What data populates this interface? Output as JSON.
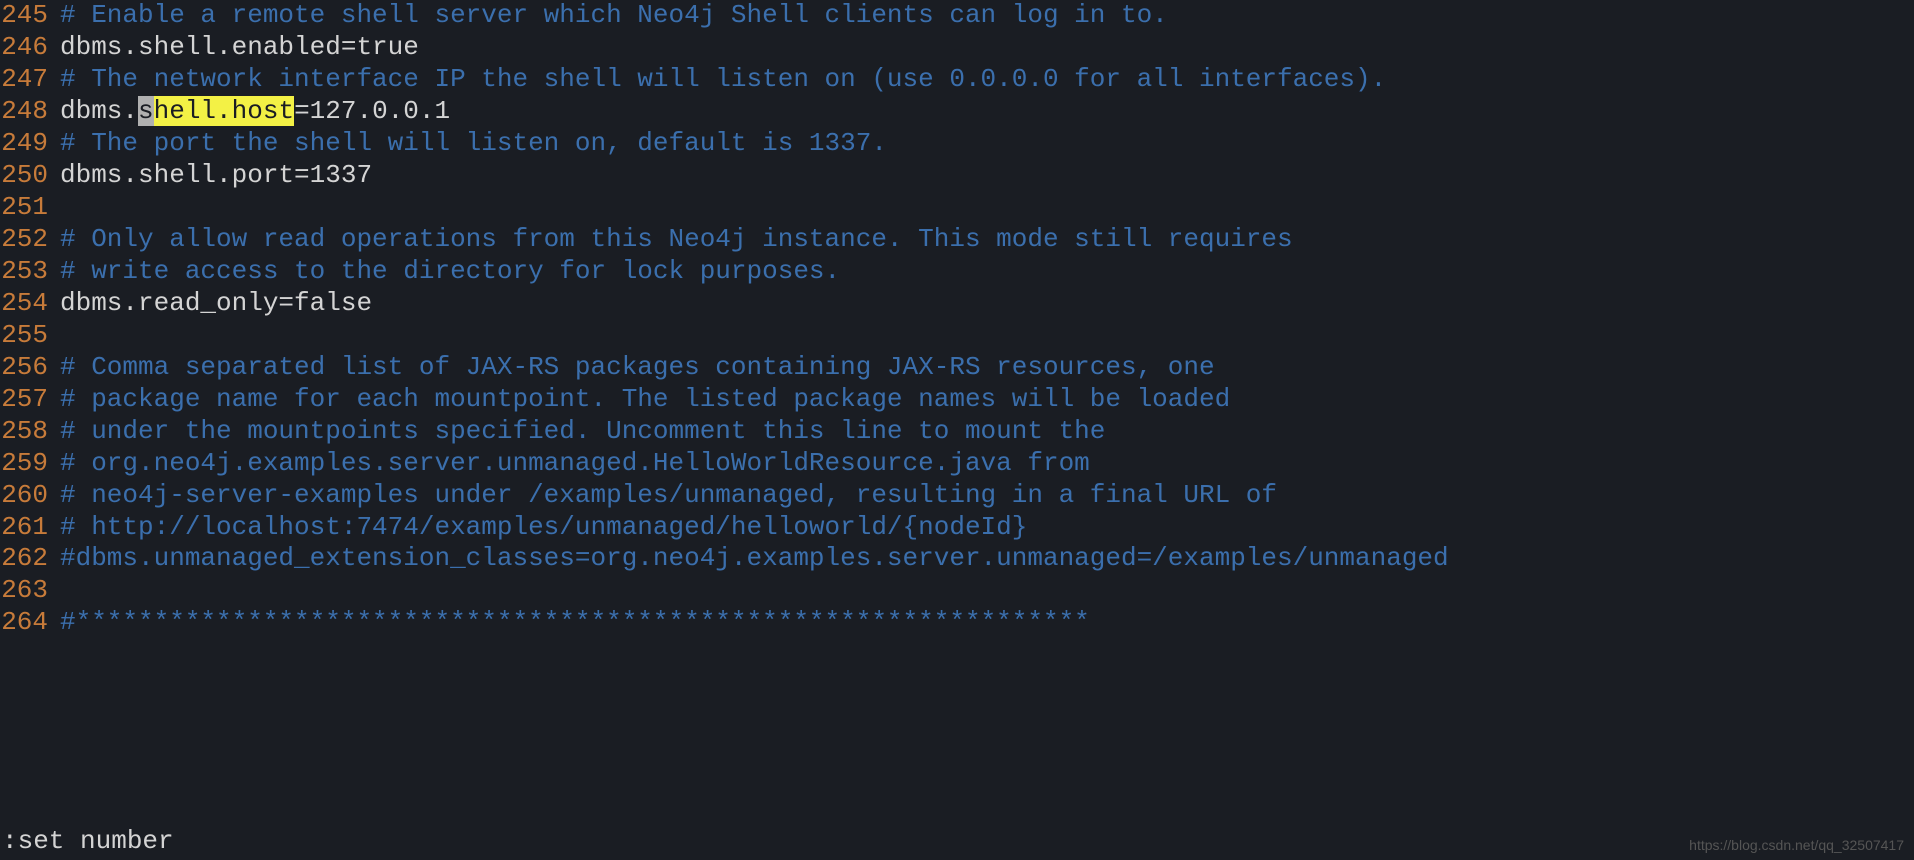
{
  "startLine": 245,
  "lines": [
    {
      "n": "245",
      "spans": [
        {
          "cls": "comment",
          "t": "# Enable a remote shell server which Neo4j Shell clients can log in to."
        }
      ]
    },
    {
      "n": "246",
      "spans": [
        {
          "cls": "setting",
          "t": "dbms.shell.enabled=true"
        }
      ]
    },
    {
      "n": "247",
      "spans": [
        {
          "cls": "comment",
          "t": "# The network interface IP the shell will listen on (use 0.0.0.0 for all interfaces)."
        }
      ]
    },
    {
      "n": "248",
      "spans": [
        {
          "cls": "setting",
          "t": "dbms."
        },
        {
          "cls": "highlight-partial-bg",
          "t": "s"
        },
        {
          "cls": "highlight",
          "t": "hell.host"
        },
        {
          "cls": "setting",
          "t": "=127.0.0.1"
        }
      ]
    },
    {
      "n": "249",
      "spans": [
        {
          "cls": "comment",
          "t": "# The port the shell will listen on, default is 1337."
        }
      ]
    },
    {
      "n": "250",
      "spans": [
        {
          "cls": "setting",
          "t": "dbms.shell.port=1337"
        }
      ]
    },
    {
      "n": "251",
      "spans": []
    },
    {
      "n": "252",
      "spans": [
        {
          "cls": "comment",
          "t": "# Only allow read operations from this Neo4j instance. This mode still requires"
        }
      ]
    },
    {
      "n": "253",
      "spans": [
        {
          "cls": "comment",
          "t": "# write access to the directory for lock purposes."
        }
      ]
    },
    {
      "n": "254",
      "spans": [
        {
          "cls": "setting",
          "t": "dbms.read_only=false"
        }
      ]
    },
    {
      "n": "255",
      "spans": []
    },
    {
      "n": "256",
      "spans": [
        {
          "cls": "comment",
          "t": "# Comma separated list of JAX-RS packages containing JAX-RS resources, one"
        }
      ]
    },
    {
      "n": "257",
      "spans": [
        {
          "cls": "comment",
          "t": "# package name for each mountpoint. The listed package names will be loaded"
        }
      ]
    },
    {
      "n": "258",
      "spans": [
        {
          "cls": "comment",
          "t": "# under the mountpoints specified. Uncomment this line to mount the"
        }
      ]
    },
    {
      "n": "259",
      "spans": [
        {
          "cls": "comment",
          "t": "# org.neo4j.examples.server.unmanaged.HelloWorldResource.java from"
        }
      ]
    },
    {
      "n": "260",
      "spans": [
        {
          "cls": "comment",
          "t": "# neo4j-server-examples under /examples/unmanaged, resulting in a final URL of"
        }
      ]
    },
    {
      "n": "261",
      "spans": [
        {
          "cls": "comment",
          "t": "# http://localhost:7474/examples/unmanaged/helloworld/{nodeId}"
        }
      ]
    },
    {
      "n": "262",
      "spans": [
        {
          "cls": "comment",
          "t": "#dbms.unmanaged_extension_classes=org.neo4j.examples.server.unmanaged=/examples/unmanaged"
        }
      ]
    },
    {
      "n": "263",
      "spans": []
    },
    {
      "n": "264",
      "spans": [
        {
          "cls": "comment",
          "t": "#*****************************************************************"
        }
      ]
    }
  ],
  "commandLine": ":set number",
  "watermark": "https://blog.csdn.net/qq_32507417"
}
